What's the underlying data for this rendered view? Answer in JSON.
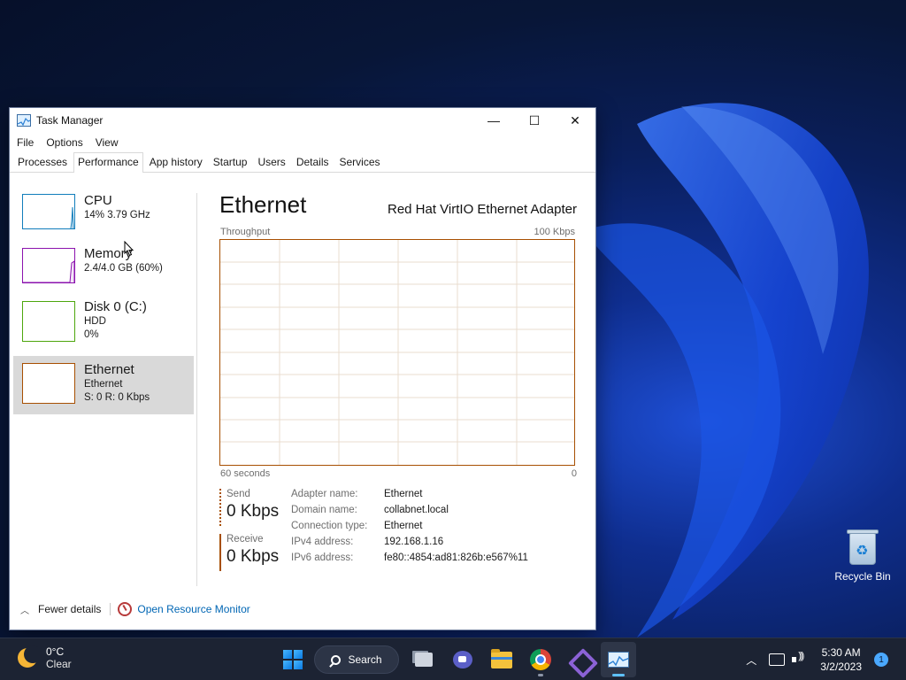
{
  "window": {
    "title": "Task Manager",
    "minimize": "—",
    "maximize": "☐",
    "close": "✕"
  },
  "menu": [
    "File",
    "Options",
    "View"
  ],
  "tabs": [
    "Processes",
    "Performance",
    "App history",
    "Startup",
    "Users",
    "Details",
    "Services"
  ],
  "sidebar": {
    "items": [
      {
        "name": "CPU",
        "line1": "14%  3.79 GHz",
        "line2": "",
        "color": "#117dbb"
      },
      {
        "name": "Memory",
        "line1": "2.4/4.0 GB (60%)",
        "line2": "",
        "color": "#8b12ae"
      },
      {
        "name": "Disk 0 (C:)",
        "line1": "HDD",
        "line2": "0%",
        "color": "#4da60c"
      },
      {
        "name": "Ethernet",
        "line1": "Ethernet",
        "line2": "S: 0  R: 0 Kbps",
        "color": "#a74f01"
      }
    ]
  },
  "detail": {
    "title": "Ethernet",
    "adapter": "Red Hat VirtIO Ethernet Adapter",
    "graph_label": "Throughput",
    "graph_max": "100 Kbps",
    "time_span": "60 seconds",
    "time_end": "0",
    "send_label": "Send",
    "send_value": "0 Kbps",
    "receive_label": "Receive",
    "receive_value": "0 Kbps",
    "properties": [
      {
        "key": "Adapter name:",
        "value": "Ethernet"
      },
      {
        "key": "Domain name:",
        "value": "collabnet.local"
      },
      {
        "key": "Connection type:",
        "value": "Ethernet"
      },
      {
        "key": "IPv4 address:",
        "value": "192.168.1.16"
      },
      {
        "key": "IPv6 address:",
        "value": "fe80::4854:ad81:826b:e567%11"
      }
    ]
  },
  "footer": {
    "fewer_details": "Fewer details",
    "open_resource_monitor": "Open Resource Monitor"
  },
  "desktop": {
    "recycle_bin": "Recycle Bin"
  },
  "taskbar": {
    "weather_temp": "0°C",
    "weather_cond": "Clear",
    "search_label": "Search",
    "time": "5:30 AM",
    "date": "3/2/2023",
    "notification_count": "1"
  },
  "colors": {
    "ethernet_accent": "#a74f01",
    "link": "#0066b4"
  }
}
